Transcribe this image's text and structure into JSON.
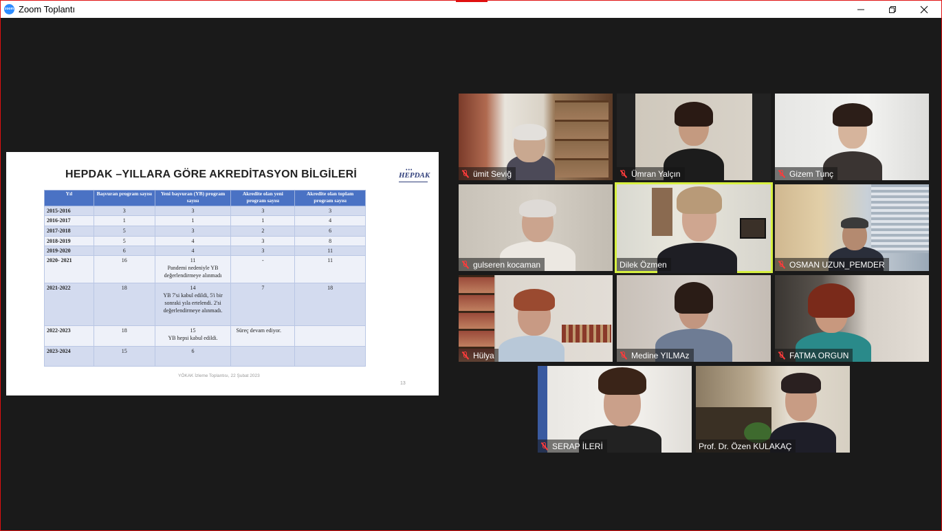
{
  "window": {
    "title": "Zoom Toplantı"
  },
  "slide": {
    "title": "HEPDAK –YILLARA GÖRE AKREDİTASYON BİLGİLERİ",
    "logo_text": "HEPDAK",
    "logo_subtext": "•••",
    "headers": [
      "Yıl",
      "Başvuran program sayısı",
      "Yeni başvuran (YB) program sayısı",
      "Akredite olan yeni program sayısı",
      "Akredite olan toplam program sayısı"
    ],
    "rows": [
      {
        "year": "2015-2016",
        "applied": "3",
        "new": "3",
        "new_note": "",
        "accredited_new": "3",
        "accredited_total": "3"
      },
      {
        "year": "2016-2017",
        "applied": "1",
        "new": "1",
        "new_note": "",
        "accredited_new": "1",
        "accredited_total": "4"
      },
      {
        "year": "2017-2018",
        "applied": "5",
        "new": "3",
        "new_note": "",
        "accredited_new": "2",
        "accredited_total": "6"
      },
      {
        "year": "2018-2019",
        "applied": "5",
        "new": "4",
        "new_note": "",
        "accredited_new": "3",
        "accredited_total": "8"
      },
      {
        "year": "2019-2020",
        "applied": "6",
        "new": "4",
        "new_note": "",
        "accredited_new": "3",
        "accredited_total": "11"
      },
      {
        "year": "2020- 2021",
        "applied": "16",
        "new": "11",
        "new_note": "Pandemi nedeniyle YB değerlendirmeye alınmadı",
        "accredited_new": "-",
        "accredited_total": "11"
      },
      {
        "year": "2021-2022",
        "applied": "18",
        "new": "14",
        "new_note": "YB 7'si kabul edildi, 5'i bir sonraki yıla ertelendi. 2'si değerlendirmeye alınmadı.",
        "accredited_new": "7",
        "accredited_total": "18"
      },
      {
        "year": "2022-2023",
        "applied": "18",
        "new": "15",
        "new_note": "YB hepsi kabul edildi.",
        "accredited_new": "Süreç devam ediyor.",
        "accredited_total": ""
      },
      {
        "year": "2023-2024",
        "applied": "15",
        "new": "6",
        "new_note": "",
        "accredited_new": "",
        "accredited_total": ""
      }
    ],
    "footer": "YÖKAK İzleme Toplantısı, 22 Şubat 2023",
    "page_number": "13"
  },
  "participants": [
    {
      "name": "ümit Seviğ",
      "muted": true
    },
    {
      "name": "Ümran Yalçın",
      "muted": true
    },
    {
      "name": "Gizem Tunç",
      "muted": true
    },
    {
      "name": "gulseren kocaman",
      "muted": true
    },
    {
      "name": "Dilek Özmen",
      "muted": false,
      "active_speaker": true
    },
    {
      "name": "OSMAN UZUN_PEMDER",
      "muted": true
    },
    {
      "name": "Hülya",
      "muted": true
    },
    {
      "name": "Medine YILMAz",
      "muted": true
    },
    {
      "name": "FATMA ORGUN",
      "muted": true
    },
    {
      "name": "SERAP İLERİ",
      "muted": true
    },
    {
      "name": "Prof. Dr. Özen KULAKAÇ",
      "muted": false
    }
  ],
  "icons": {
    "app": "zoom-icon",
    "minimize": "minimize-icon",
    "restore": "restore-icon",
    "close": "close-icon",
    "muted": "muted-microphone-icon"
  },
  "colors": {
    "frame": "#e01010",
    "table_header": "#4a72c4",
    "active_speaker": "#d7f040",
    "muted": "#ff3b3b"
  }
}
